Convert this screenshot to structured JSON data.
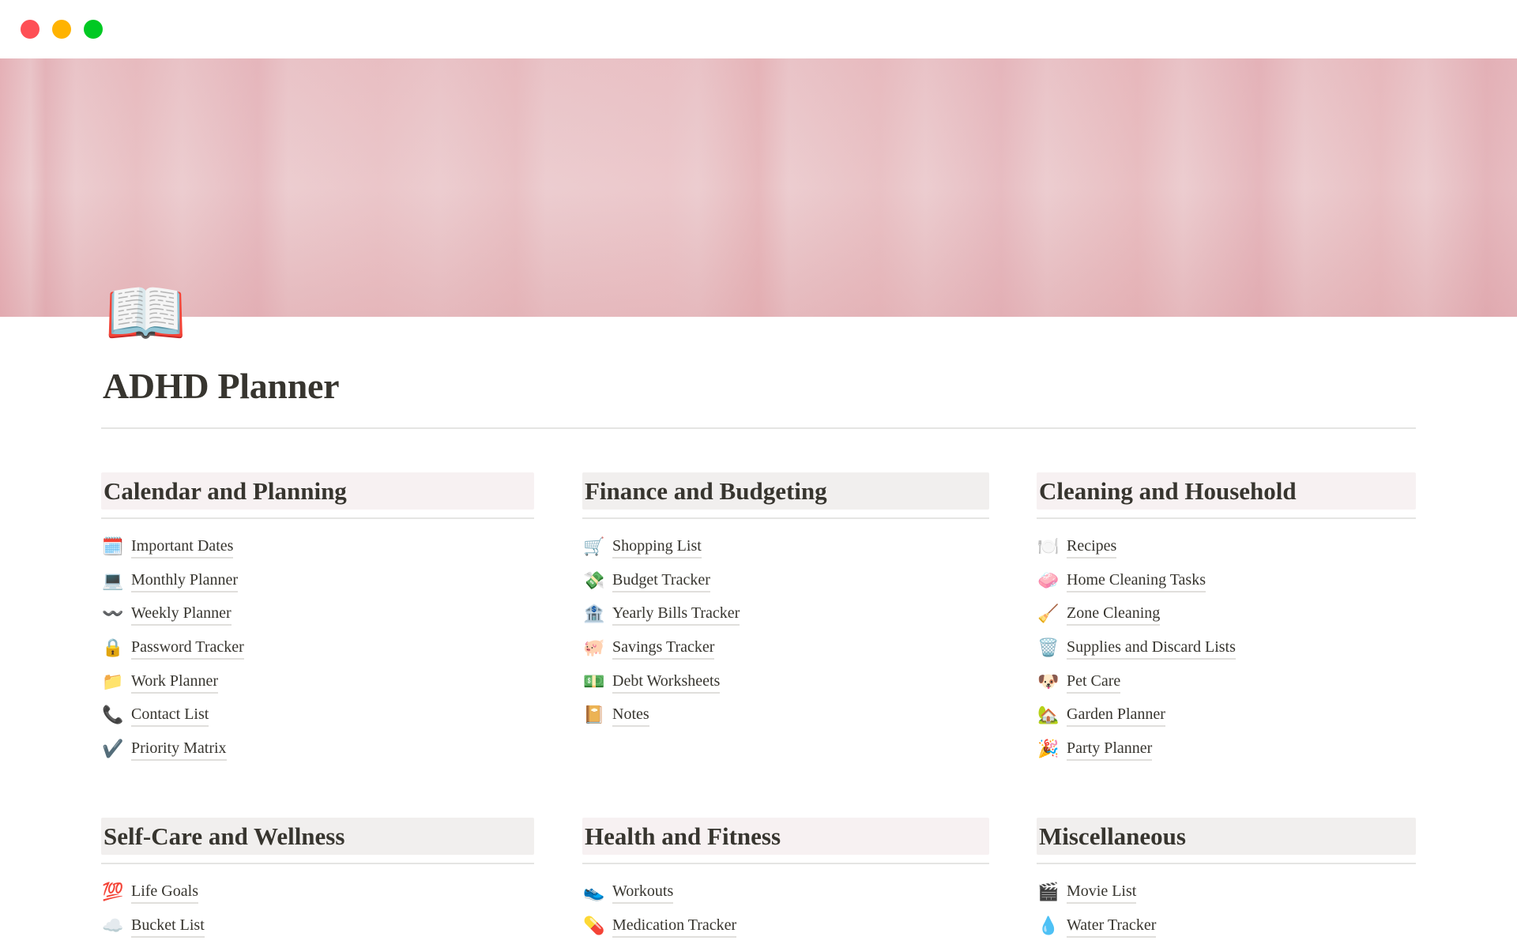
{
  "window": {
    "controls": [
      "close",
      "minimize",
      "zoom"
    ]
  },
  "page": {
    "icon": "open-book",
    "icon_glyph": "📖",
    "title": "ADHD Planner"
  },
  "sections": [
    {
      "heading": "Calendar and Planning",
      "items": [
        {
          "icon": "calendar-icon",
          "glyph": "🗓️",
          "label": "Important Dates"
        },
        {
          "icon": "laptop-icon",
          "glyph": "💻",
          "label": "Monthly Planner"
        },
        {
          "icon": "wavy-dash-icon",
          "glyph": "〰️",
          "label": "Weekly Planner"
        },
        {
          "icon": "lock-icon",
          "glyph": "🔒",
          "label": "Password Tracker"
        },
        {
          "icon": "folder-icon",
          "glyph": "📁",
          "label": "Work Planner"
        },
        {
          "icon": "telephone-icon",
          "glyph": "📞",
          "label": "Contact List"
        },
        {
          "icon": "check-mark-icon",
          "glyph": "✔️",
          "label": "Priority Matrix"
        }
      ]
    },
    {
      "heading": "Finance and Budgeting",
      "items": [
        {
          "icon": "shopping-cart-icon",
          "glyph": "🛒",
          "label": "Shopping List"
        },
        {
          "icon": "money-with-wings-icon",
          "glyph": "💸",
          "label": "Budget Tracker"
        },
        {
          "icon": "bank-icon",
          "glyph": "🏦",
          "label": "Yearly Bills Tracker"
        },
        {
          "icon": "pig-icon",
          "glyph": "🐖",
          "label": "Savings Tracker"
        },
        {
          "icon": "dollar-banknote-icon",
          "glyph": "💵",
          "label": "Debt Worksheets"
        },
        {
          "icon": "notebook-icon",
          "glyph": "📔",
          "label": "Notes"
        }
      ]
    },
    {
      "heading": "Cleaning and Household",
      "items": [
        {
          "icon": "plate-cutlery-icon",
          "glyph": "🍽️",
          "label": "Recipes"
        },
        {
          "icon": "soap-icon",
          "glyph": "🧼",
          "label": "Home Cleaning Tasks"
        },
        {
          "icon": "broom-icon",
          "glyph": "🧹",
          "label": "Zone Cleaning"
        },
        {
          "icon": "wastebasket-icon",
          "glyph": "🗑️",
          "label": "Supplies and Discard Lists"
        },
        {
          "icon": "dog-face-icon",
          "glyph": "🐶",
          "label": "Pet Care"
        },
        {
          "icon": "house-garden-icon",
          "glyph": "🏡",
          "label": "Garden Planner"
        },
        {
          "icon": "party-popper-icon",
          "glyph": "🎉",
          "label": "Party Planner"
        }
      ]
    },
    {
      "heading": "Self-Care and Wellness",
      "items": [
        {
          "icon": "hundred-points-icon",
          "glyph": "💯",
          "label": "Life Goals"
        },
        {
          "icon": "cloud-icon",
          "glyph": "☁️",
          "label": "Bucket List"
        }
      ]
    },
    {
      "heading": "Health and Fitness",
      "items": [
        {
          "icon": "running-shoe-icon",
          "glyph": "👟",
          "label": "Workouts"
        },
        {
          "icon": "pill-icon",
          "glyph": "💊",
          "label": "Medication Tracker"
        }
      ]
    },
    {
      "heading": "Miscellaneous",
      "items": [
        {
          "icon": "clapper-board-icon",
          "glyph": "🎬",
          "label": "Movie List"
        },
        {
          "icon": "droplet-icon",
          "glyph": "💧",
          "label": "Water Tracker"
        }
      ]
    }
  ]
}
